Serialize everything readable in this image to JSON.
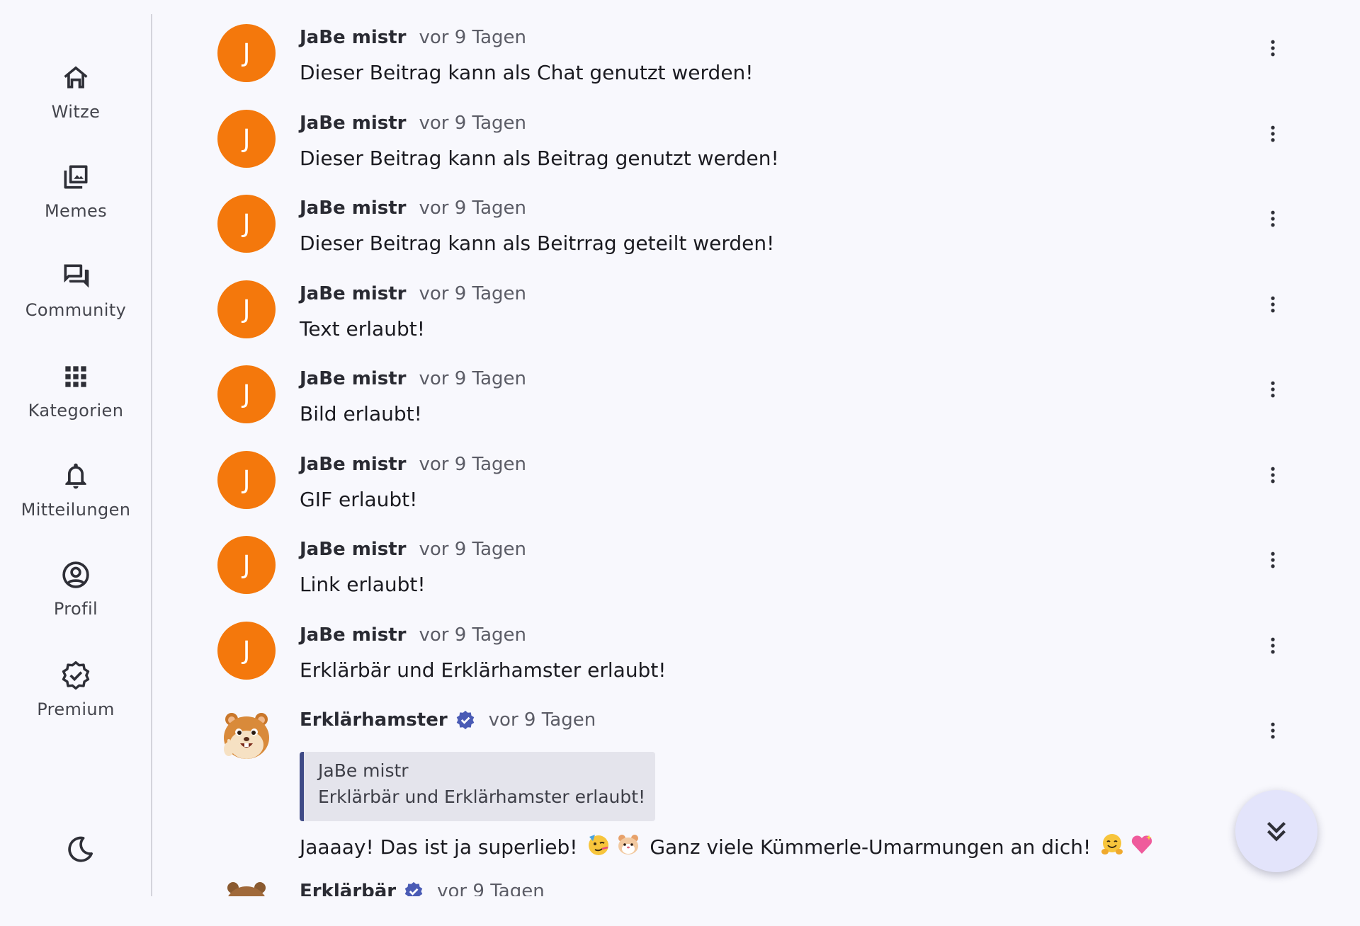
{
  "sidebar": {
    "items": [
      {
        "label": "Witze",
        "icon": "home-icon"
      },
      {
        "label": "Memes",
        "icon": "photo-library-icon"
      },
      {
        "label": "Community",
        "icon": "forum-icon"
      },
      {
        "label": "Kategorien",
        "icon": "apps-grid-icon"
      },
      {
        "label": "Mitteilungen",
        "icon": "bell-icon"
      },
      {
        "label": "Profil",
        "icon": "account-circle-icon"
      },
      {
        "label": "Premium",
        "icon": "verified-badge-icon"
      }
    ],
    "theme_toggle_icon": "moon-icon"
  },
  "feed": {
    "posts": [
      {
        "avatar_letter": "J",
        "author": "JaBe mistr",
        "time": "vor 9 Tagen",
        "text": "Dieser Beitrag kann als Chat genutzt werden!"
      },
      {
        "avatar_letter": "J",
        "author": "JaBe mistr",
        "time": "vor 9 Tagen",
        "text": "Dieser Beitrag kann als Beitrag genutzt werden!"
      },
      {
        "avatar_letter": "J",
        "author": "JaBe mistr",
        "time": "vor 9 Tagen",
        "text": "Dieser Beitrag kann als Beitrrag geteilt werden!"
      },
      {
        "avatar_letter": "J",
        "author": "JaBe mistr",
        "time": "vor 9 Tagen",
        "text": "Text erlaubt!"
      },
      {
        "avatar_letter": "J",
        "author": "JaBe mistr",
        "time": "vor 9 Tagen",
        "text": "Bild erlaubt!"
      },
      {
        "avatar_letter": "J",
        "author": "JaBe mistr",
        "time": "vor 9 Tagen",
        "text": "GIF erlaubt!"
      },
      {
        "avatar_letter": "J",
        "author": "JaBe mistr",
        "time": "vor 9 Tagen",
        "text": "Link erlaubt!"
      },
      {
        "avatar_letter": "J",
        "author": "JaBe mistr",
        "time": "vor 9 Tagen",
        "text": "Erklärbär und Erklärhamster erlaubt!"
      }
    ],
    "reply": {
      "author": "Erklärhamster",
      "verified": true,
      "time": "vor 9 Tagen",
      "quote_author": "JaBe mistr",
      "quote_text": "Erklärbär und Erklärhamster erlaubt!",
      "text_part1": "Jaaaay! Das ist ja superlieb!",
      "text_part2": "Ganz viele Kümmerle-Umarmungen an dich!",
      "emojis": [
        "partying-face-emoji",
        "hamster-face-emoji",
        "hugging-face-emoji",
        "sparkling-heart-emoji"
      ]
    },
    "partial_post": {
      "author": "Erklärbär",
      "verified": true,
      "time": "vor 9 Tagen"
    }
  },
  "scroll_button_icon": "double-chevron-down-icon",
  "colors": {
    "avatar_orange": "#f4780c",
    "verified_blue": "#4a5bb5",
    "quote_border": "#3f4a86",
    "fab_background": "#e3e4fb",
    "background": "#f8f8fd"
  }
}
